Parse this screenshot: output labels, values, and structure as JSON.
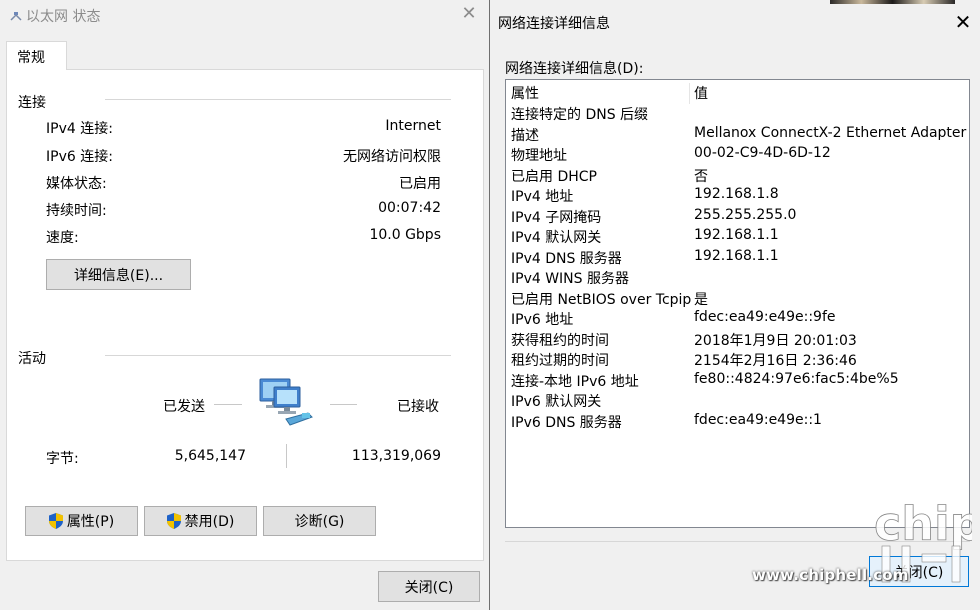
{
  "left_window": {
    "title": "以太网 状态",
    "tab": "常规",
    "connection": {
      "heading": "连接",
      "rows": [
        {
          "label": "IPv4 连接:",
          "value": "Internet"
        },
        {
          "label": "IPv6 连接:",
          "value": "无网络访问权限"
        },
        {
          "label": "媒体状态:",
          "value": "已启用"
        },
        {
          "label": "持续时间:",
          "value": "00:07:42"
        },
        {
          "label": "速度:",
          "value": "10.0 Gbps"
        }
      ],
      "details_button": "详细信息(E)..."
    },
    "activity": {
      "heading": "活动",
      "sent_label": "已发送",
      "received_label": "已接收",
      "bytes_label": "字节:",
      "bytes_sent": "5,645,147",
      "bytes_received": "113,319,069"
    },
    "buttons": {
      "properties": "属性(P)",
      "disable": "禁用(D)",
      "diagnose": "诊断(G)",
      "close": "关闭(C)"
    }
  },
  "right_window": {
    "title": "网络连接详细信息",
    "list_label": "网络连接详细信息(D):",
    "columns": {
      "property": "属性",
      "value": "值"
    },
    "rows": [
      {
        "property": "连接特定的 DNS 后缀",
        "value": ""
      },
      {
        "property": "描述",
        "value": "Mellanox ConnectX-2 Ethernet Adapter"
      },
      {
        "property": "物理地址",
        "value": "00-02-C9-4D-6D-12"
      },
      {
        "property": "已启用 DHCP",
        "value": "否"
      },
      {
        "property": "IPv4 地址",
        "value": "192.168.1.8"
      },
      {
        "property": "IPv4 子网掩码",
        "value": "255.255.255.0"
      },
      {
        "property": "IPv4 默认网关",
        "value": "192.168.1.1"
      },
      {
        "property": "IPv4 DNS 服务器",
        "value": "192.168.1.1"
      },
      {
        "property": "IPv4 WINS 服务器",
        "value": ""
      },
      {
        "property": "已启用 NetBIOS over Tcpip",
        "value": "是"
      },
      {
        "property": "IPv6 地址",
        "value": "fdec:ea49:e49e::9fe"
      },
      {
        "property": "获得租约的时间",
        "value": "2018年1月9日 20:01:03"
      },
      {
        "property": "租约过期的时间",
        "value": "2154年2月16日 2:36:46"
      },
      {
        "property": "连接-本地 IPv6 地址",
        "value": "fe80::4824:97e6:fac5:4be%5"
      },
      {
        "property": "IPv6 默认网关",
        "value": ""
      },
      {
        "property": "IPv6 DNS 服务器",
        "value": "fdec:ea49:e49e::1"
      }
    ],
    "close_button": "关闭(C)"
  },
  "watermark": {
    "url": "www.chiphell.com",
    "logo_text": "chip"
  },
  "colors": {
    "window_bg": "#f0f0f0",
    "focus_border": "#0078d7",
    "shield_blue": "#1e62c8",
    "shield_yellow": "#f2c200"
  },
  "icons": [
    "network-small-icon",
    "close-icon",
    "network-computers-icon",
    "uac-shield-icon"
  ]
}
